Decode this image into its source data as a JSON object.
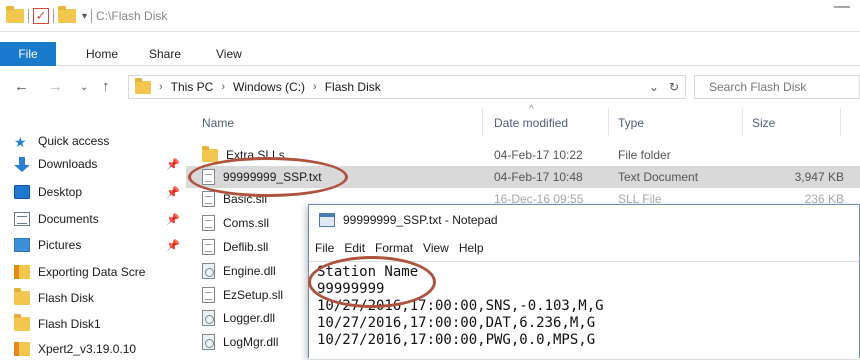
{
  "window": {
    "title_path": "C:\\Flash Disk",
    "minimize_symbol": "—"
  },
  "ribbon": {
    "tabs": [
      "File",
      "Home",
      "Share",
      "View"
    ]
  },
  "address": {
    "crumbs": [
      "This PC",
      "Windows (C:)",
      "Flash Disk"
    ],
    "search_placeholder": "Search Flash Disk"
  },
  "nav_pane": {
    "items": [
      {
        "label": "Quick access",
        "icon": "star-icon",
        "pinned": false
      },
      {
        "label": "Downloads",
        "icon": "download-arrow-icon",
        "pinned": true
      },
      {
        "label": "Desktop",
        "icon": "desktop-icon",
        "pinned": true
      },
      {
        "label": "Documents",
        "icon": "documents-icon",
        "pinned": true
      },
      {
        "label": "Pictures",
        "icon": "pictures-icon",
        "pinned": true
      },
      {
        "label": "Exporting Data Scre",
        "icon": "folder-icon",
        "pinned": false
      },
      {
        "label": "Flash Disk",
        "icon": "folder-icon",
        "pinned": false
      },
      {
        "label": "Flash Disk1",
        "icon": "folder-icon",
        "pinned": false
      },
      {
        "label": "Xpert2_v3.19.0.10",
        "icon": "folder-icon",
        "pinned": false
      }
    ]
  },
  "file_list": {
    "columns": [
      "Name",
      "Date modified",
      "Type",
      "Size"
    ],
    "rows": [
      {
        "name": "Extra SLLs",
        "date": "04-Feb-17 10:22",
        "type": "File folder",
        "size": "",
        "icon": "folder-icon"
      },
      {
        "name": "99999999_SSP.txt",
        "date": "04-Feb-17 10:48",
        "type": "Text Document",
        "size": "3,947 KB",
        "icon": "text-file-icon",
        "selected": true
      },
      {
        "name": "Basic.sll",
        "date": "16-Dec-16 09:55",
        "type": "SLL File",
        "size": "236 KB",
        "icon": "file-icon"
      },
      {
        "name": "Coms.sll",
        "date": "",
        "type": "",
        "size": "",
        "icon": "file-icon"
      },
      {
        "name": "Deflib.sll",
        "date": "",
        "type": "",
        "size": "",
        "icon": "file-icon"
      },
      {
        "name": "Engine.dll",
        "date": "",
        "type": "",
        "size": "",
        "icon": "dll-icon"
      },
      {
        "name": "EzSetup.sll",
        "date": "",
        "type": "",
        "size": "",
        "icon": "file-icon"
      },
      {
        "name": "Logger.dll",
        "date": "",
        "type": "",
        "size": "",
        "icon": "dll-icon"
      },
      {
        "name": "LogMgr.dll",
        "date": "",
        "type": "",
        "size": "",
        "icon": "dll-icon"
      }
    ]
  },
  "notepad": {
    "title": "99999999_SSP.txt - Notepad",
    "menu": [
      "File",
      "Edit",
      "Format",
      "View",
      "Help"
    ],
    "lines": [
      "Station Name",
      "99999999",
      "10/27/2016,17:00:00,SNS,-0.103,M,G",
      "10/27/2016,17:00:00,DAT,6.236,M,G",
      "10/27/2016,17:00:00,PWG,0.0,MPS,G"
    ]
  },
  "colors": {
    "file_tab": "#1979ca",
    "selection": "#d9d9d9",
    "annotation_oval": "#b0533e",
    "folder": "#f3c74f",
    "quick_access_star": "#2a7fd4"
  }
}
